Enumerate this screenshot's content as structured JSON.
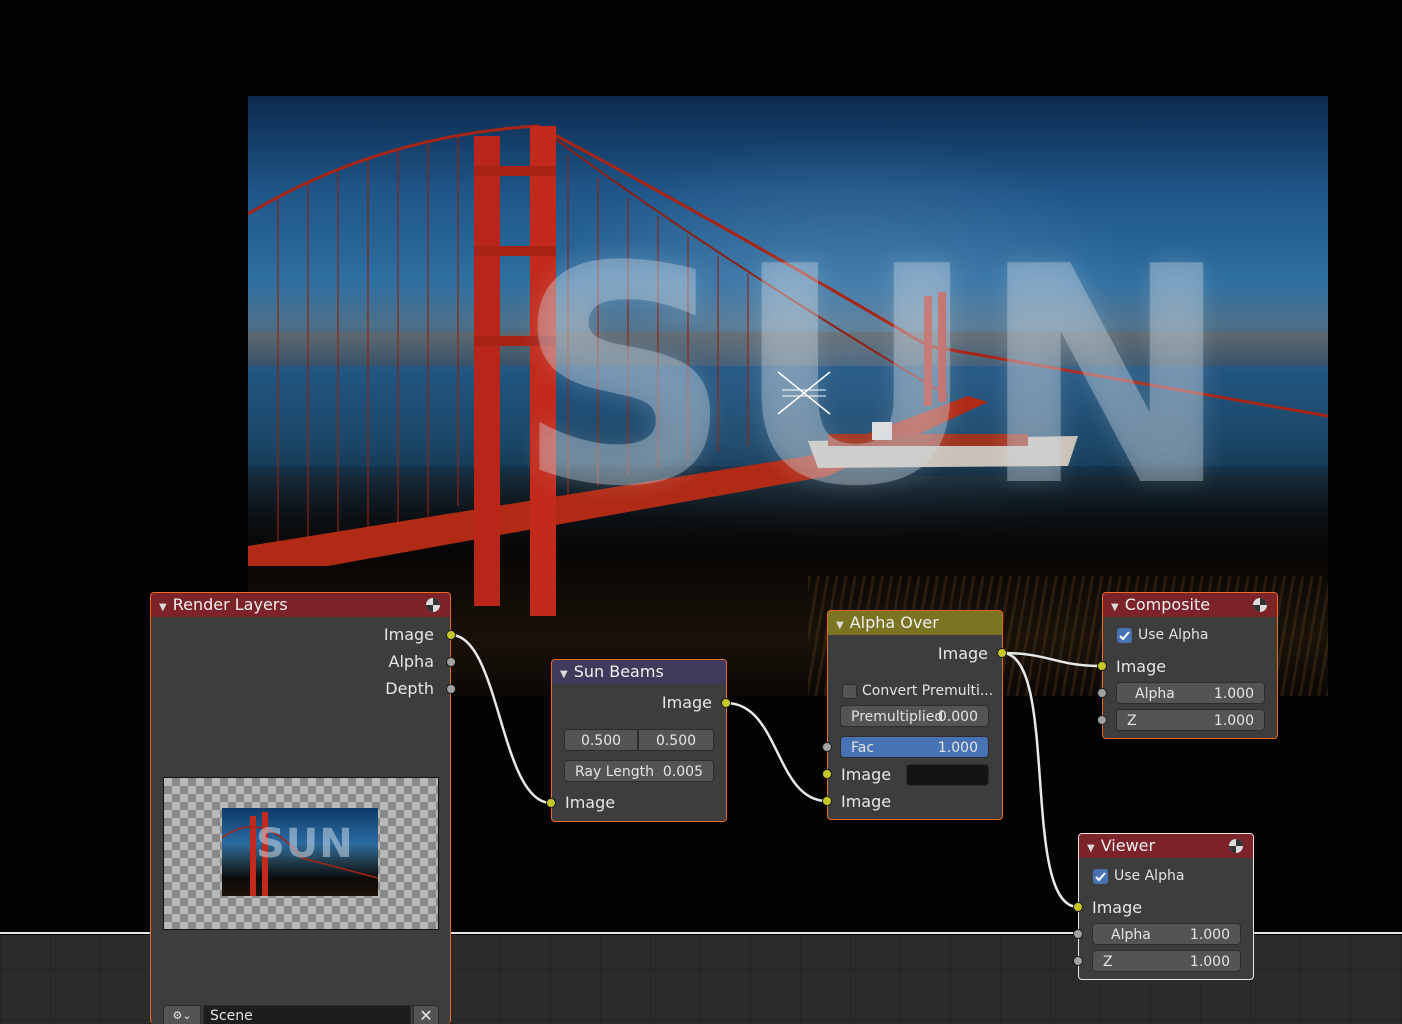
{
  "backdrop": {
    "overlay_text": "SUN"
  },
  "colors": {
    "node_border_selected": "#ee6a1c",
    "node_border_active": "#e8e8e8",
    "header_output": "#7b2328",
    "header_filter": "#41395c",
    "header_color": "#7b7423",
    "socket_color": "#c7c729",
    "socket_value": "#a1a1a1",
    "field_active": "#4772b3"
  },
  "nodes": {
    "render_layers": {
      "title": "Render Layers",
      "outputs": [
        "Image",
        "Alpha",
        "Depth"
      ],
      "scene": {
        "icon": "scene-icon",
        "value": "Scene",
        "clear": "✕"
      }
    },
    "sun_beams": {
      "title": "Sun Beams",
      "output": "Image",
      "source_x": "0.500",
      "source_y": "0.500",
      "ray_length": {
        "label": "Ray Length",
        "value": "0.005"
      },
      "input": "Image"
    },
    "alpha_over": {
      "title": "Alpha Over",
      "output": "Image",
      "convert_premult": {
        "label": "Convert Premulti...",
        "checked": false
      },
      "premultiplied": {
        "label": "Premultiplied",
        "value": "0.000"
      },
      "fac": {
        "label": "Fac",
        "value": "1.000"
      },
      "input1": "Image",
      "input2": "Image"
    },
    "composite": {
      "title": "Composite",
      "use_alpha": {
        "label": "Use Alpha",
        "checked": true
      },
      "input": "Image",
      "alpha": {
        "label": "Alpha",
        "value": "1.000"
      },
      "z": {
        "label": "Z",
        "value": "1.000"
      }
    },
    "viewer": {
      "title": "Viewer",
      "use_alpha": {
        "label": "Use Alpha",
        "checked": true
      },
      "input": "Image",
      "alpha": {
        "label": "Alpha",
        "value": "1.000"
      },
      "z": {
        "label": "Z",
        "value": "1.000"
      }
    }
  }
}
